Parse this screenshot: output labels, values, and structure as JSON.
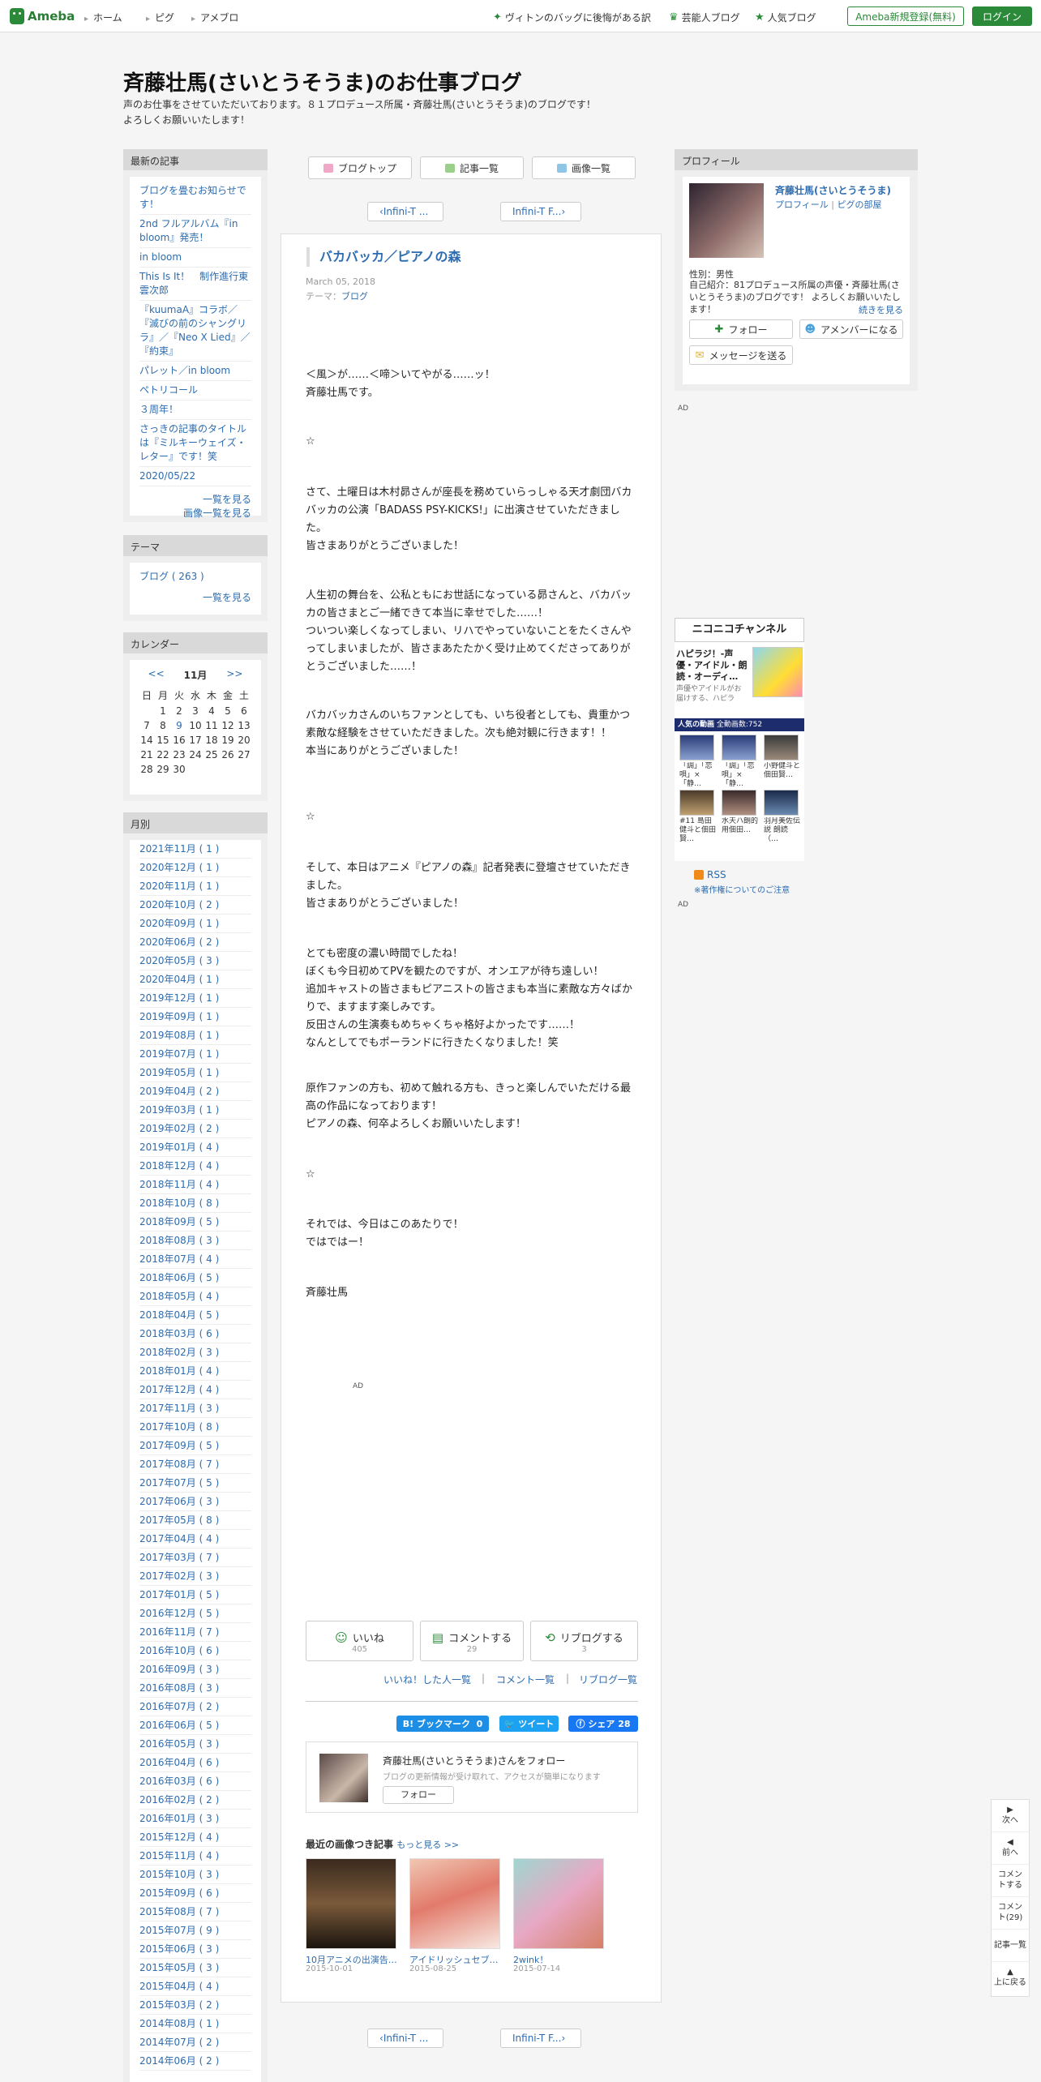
{
  "header": {
    "logo": "Ameba",
    "nav": [
      "ホーム",
      "ピグ",
      "アメブロ"
    ],
    "right_links": [
      "ヴィトンのバッグに後悔がある訳",
      "芸能人ブログ",
      "人気ブログ"
    ],
    "register": "Ameba新規登録(無料)",
    "login": "ログイン"
  },
  "blog": {
    "title": "斉藤壮馬(さいとうそうま)のお仕事ブログ",
    "description_line1": "声のお仕事をさせていただいております。８１プロデュース所属・斉藤壮馬(さいとうそうま)のブログです！",
    "description_line2": "よろしくお願いいたします！"
  },
  "left": {
    "recent_heading": "最新の記事",
    "recent": [
      "ブログを畳むお知らせです！",
      "2nd フルアルバム『in bloom』発売！",
      "in bloom",
      "This Is It！　制作進行東雲次郎",
      "『kuumaA』コラボ／『滅びの前のシャングリラ』／『Neo X Lied』／『約束』",
      "パレット／in bloom",
      "ペトリコール",
      "３周年！",
      "さっきの記事のタイトルは『ミルキーウェイズ・レター』です！笑",
      "2020/05/22"
    ],
    "recent_more": "一覧を見る",
    "recent_images": "画像一覧を見る",
    "theme_heading": "テーマ",
    "theme_item": "ブログ ( 263 )",
    "theme_more": "一覧を見る",
    "calendar_heading": "カレンダー",
    "calendar": {
      "prev": "<<",
      "month": "11月",
      "next": ">>",
      "weekdays": [
        "日",
        "月",
        "火",
        "水",
        "木",
        "金",
        "土"
      ],
      "days": [
        "",
        "1",
        "2",
        "3",
        "4",
        "5",
        "6",
        "7",
        "8",
        "9",
        "10",
        "11",
        "12",
        "13",
        "14",
        "15",
        "16",
        "17",
        "18",
        "19",
        "20",
        "21",
        "22",
        "23",
        "24",
        "25",
        "26",
        "27",
        "28",
        "29",
        "30",
        "",
        "",
        "",
        "",
        ""
      ]
    },
    "monthly_heading": "月別",
    "months": [
      "2021年11月 ( 1 )",
      "2020年12月 ( 1 )",
      "2020年11月 ( 1 )",
      "2020年10月 ( 2 )",
      "2020年09月 ( 1 )",
      "2020年06月 ( 2 )",
      "2020年05月 ( 3 )",
      "2020年04月 ( 1 )",
      "2019年12月 ( 1 )",
      "2019年09月 ( 1 )",
      "2019年08月 ( 1 )",
      "2019年07月 ( 1 )",
      "2019年05月 ( 1 )",
      "2019年04月 ( 2 )",
      "2019年03月 ( 1 )",
      "2019年02月 ( 2 )",
      "2019年01月 ( 4 )",
      "2018年12月 ( 4 )",
      "2018年11月 ( 4 )",
      "2018年10月 ( 8 )",
      "2018年09月 ( 5 )",
      "2018年08月 ( 3 )",
      "2018年07月 ( 4 )",
      "2018年06月 ( 5 )",
      "2018年05月 ( 4 )",
      "2018年04月 ( 5 )",
      "2018年03月 ( 6 )",
      "2018年02月 ( 3 )",
      "2018年01月 ( 4 )",
      "2017年12月 ( 4 )",
      "2017年11月 ( 3 )",
      "2017年10月 ( 8 )",
      "2017年09月 ( 5 )",
      "2017年08月 ( 7 )",
      "2017年07月 ( 5 )",
      "2017年06月 ( 3 )",
      "2017年05月 ( 8 )",
      "2017年04月 ( 4 )",
      "2017年03月 ( 7 )",
      "2017年02月 ( 3 )",
      "2017年01月 ( 5 )",
      "2016年12月 ( 5 )",
      "2016年11月 ( 7 )",
      "2016年10月 ( 6 )",
      "2016年09月 ( 3 )",
      "2016年08月 ( 3 )",
      "2016年07月 ( 2 )",
      "2016年06月 ( 5 )",
      "2016年05月 ( 3 )",
      "2016年04月 ( 6 )",
      "2016年03月 ( 6 )",
      "2016年02月 ( 2 )",
      "2016年01月 ( 3 )",
      "2015年12月 ( 4 )",
      "2015年11月 ( 4 )",
      "2015年10月 ( 3 )",
      "2015年09月 ( 6 )",
      "2015年08月 ( 7 )",
      "2015年07月 ( 9 )",
      "2015年06月 ( 3 )",
      "2015年05月 ( 3 )",
      "2015年04月 ( 4 )",
      "2015年03月 ( 2 )",
      "2014年08月 ( 1 )",
      "2014年07月 ( 2 )",
      "2014年06月 ( 2 )"
    ]
  },
  "main": {
    "top_buttons": [
      "ブログトップ",
      "記事一覧",
      "画像一覧"
    ],
    "pager_prev": "Infini-T ...",
    "pager_next": "Infini-T F...",
    "entry_title": "バカバッカ／ピアノの森",
    "entry_date": "March 05, 2018",
    "entry_theme_label": "テーマ：",
    "entry_theme": "ブログ",
    "paragraphs": [
      "＜風＞が……＜啼＞いてやがる……ッ！\n斉藤壮馬です。",
      "☆",
      "さて、土曜日は木村昴さんが座長を務めていらっしゃる天才劇団バカバッカの公演「BADASS PSY-KICKS!」に出演させていただきました。\n皆さまありがとうございました！",
      "人生初の舞台を、公私ともにお世話になっている昴さんと、バカバッカの皆さまとご一緒できて本当に幸せでした……！\nついつい楽しくなってしまい、リハでやっていないことをたくさんやってしまいましたが、皆さまあたたかく受け止めてくださってありがとうございました……！",
      "バカバッカさんのいちファンとしても、いち役者としても、貴重かつ素敵な経験をさせていただきました。次も絶対観に行きます！！\n本当にありがとうございました！",
      "☆",
      "そして、本日はアニメ『ピアノの森』記者発表に登壇させていただきました。\n皆さまありがとうございました！",
      "とても密度の濃い時間でしたね！\nぼくも今日初めてPVを観たのですが、オンエアが待ち遠しい！\n追加キャストの皆さまもピアニストの皆さまも本当に素敵な方々ばかりで、ますます楽しみです。\n反田さんの生演奏もめちゃくちゃ格好よかったです……！\nなんとしてでもポーランドに行きたくなりました！笑",
      "原作ファンの方も、初めて触れる方も、きっと楽しんでいただける最高の作品になっております！\nピアノの森、何卒よろしくお願いいたします！",
      "☆",
      "それでは、今日はこのあたりで！\nではではー！",
      "斉藤壮馬"
    ],
    "ad": "AD",
    "reactions": [
      {
        "label": "いいね",
        "count": "405"
      },
      {
        "label": "コメントする",
        "count": "29"
      },
      {
        "label": "リブログする",
        "count": "3"
      }
    ],
    "reaction_links": [
      "いいね！した人一覧",
      "コメント一覧",
      "リブログ一覧"
    ],
    "share": {
      "hatena": "B! ブックマーク",
      "hatena_count": "0",
      "tweet": "ツイート",
      "facebook": "シェア",
      "facebook_count": "28"
    },
    "follow": {
      "title": "斉藤壮馬(さいとうそうま)さんをフォロー",
      "sub": "ブログの更新情報が受け取れて、アクセスが簡単になります",
      "button": "フォロー"
    },
    "recent_images_heading": "最近の画像つき記事",
    "recent_images_more": "もっと見る >>",
    "recent_images": [
      {
        "title": "10月アニメの出演告…",
        "date": "2015-10-01"
      },
      {
        "title": "アイドリッシュセブ…",
        "date": "2015-08-25"
      },
      {
        "title": "2wink！",
        "date": "2015-07-14"
      }
    ]
  },
  "right": {
    "profile_heading": "プロフィール",
    "profile_name": "斉藤壮馬(さいとうそうま)",
    "profile_link1": "プロフィール",
    "profile_link2": "ピグの部屋",
    "gender": "性別：男性",
    "intro": "自己紹介：81プロデュース所属の声優・斉藤壮馬(さいとうそうま)のブログです！ よろしくお願いいたします！",
    "intro_more": "続きを見る",
    "follow_btn": "フォロー",
    "member_btn": "アメンバーになる",
    "message_btn": "メッセージを送る",
    "ad": "AD",
    "nico": {
      "logo": "ニコニコチャンネル",
      "title": "ハピラジ！-声優・アイドル・朗読・オーディ…",
      "desc": "声優やアイドルがお届けする、ハピラ",
      "bar": "人気の動画",
      "bar_count": "全動画数:752",
      "captions": [
        "「調」「恋唄」×「静…",
        "「調」「恋唄」×「静…",
        "小野健斗と佃田賢…",
        "#11 島田健斗と佃田賢…",
        "水天ハ朗的用佃田…",
        "羽月美佐伝説 朗読（…"
      ]
    },
    "rss": "RSS",
    "copyright": "※著作権についてのご注意"
  },
  "float_nav": [
    "次へ",
    "前へ",
    "コメントする",
    "コメント(29)",
    "記事一覧",
    "上に戻る"
  ],
  "colors": {
    "accent": "#2a8a39",
    "link": "#2d6cb0"
  }
}
